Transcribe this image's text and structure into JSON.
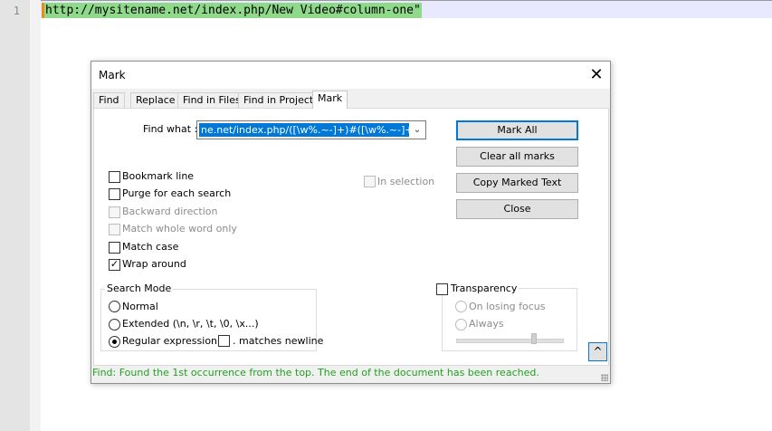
{
  "editor": {
    "line_number": "1",
    "line_text": "http://mysitename.net/index.php/New Video#column-one\""
  },
  "dialog": {
    "title": "Mark",
    "close_glyph": "✕",
    "tabs": [
      "Find",
      "Replace",
      "Find in Files",
      "Find in Projects",
      "Mark"
    ],
    "active_tab": "Mark",
    "find_what_label": "Find what :",
    "find_what_value": "ne.net/index.php/([\\w%.~-]+)#([\\w%.~-]+)\"",
    "buttons": {
      "mark_all": "Mark All",
      "clear_all_marks": "Clear all marks",
      "copy_marked_text": "Copy Marked Text",
      "close": "Close"
    },
    "in_selection": "In selection",
    "options": {
      "bookmark_line": "Bookmark line",
      "purge_each_search": "Purge for each search",
      "backward_direction": "Backward direction",
      "match_whole_word": "Match whole word only",
      "match_case": "Match case",
      "wrap_around": "Wrap around"
    },
    "search_mode": {
      "title": "Search Mode",
      "normal": "Normal",
      "extended": "Extended (\\n, \\r, \\t, \\0, \\x...)",
      "regex": "Regular expression",
      "dot_newline": ". matches newline"
    },
    "transparency": {
      "title": "Transparency",
      "on_losing_focus": "On losing focus",
      "always": "Always"
    },
    "collapse_glyph": "^",
    "status": "Find: Found the 1st occurrence from the top. The end of the document has been reached.",
    "status_color": "#1fa21f"
  }
}
